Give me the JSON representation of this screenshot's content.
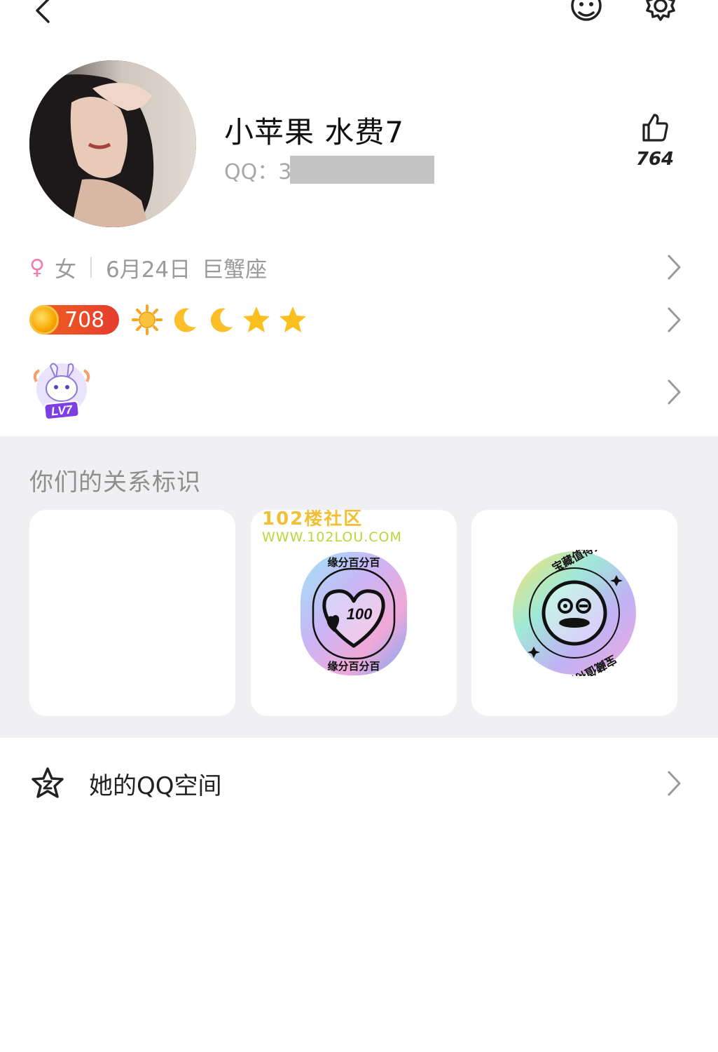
{
  "profile": {
    "nickname": "小苹果 水费7",
    "qq_label": "QQ：3",
    "likes": "764"
  },
  "info": {
    "gender_symbol": "♀",
    "gender": "女",
    "birthday": "6月24日",
    "zodiac": "巨蟹座"
  },
  "level": {
    "coin_value": "708",
    "icons": [
      "sun-icon",
      "moon-icon",
      "moon-icon",
      "star-icon",
      "star-icon"
    ]
  },
  "badge": {
    "level_badge": "LV7"
  },
  "relationship": {
    "title": "你们的关系标识",
    "card2_watermark_line1": "102楼社区",
    "card2_watermark_line2": "WWW.102LOU.COM",
    "card2_badge_text": "缘分百分百",
    "card2_badge_number": "100",
    "card3_badge_text": "宝藏值得挖掘"
  },
  "qzone": {
    "label": "她的QQ空间"
  },
  "colors": {
    "accent_female": "#f07ab0",
    "coin_badge": "#e63b2e",
    "section_bg": "#f0f0f3",
    "level_icon": "#fbb71c"
  }
}
